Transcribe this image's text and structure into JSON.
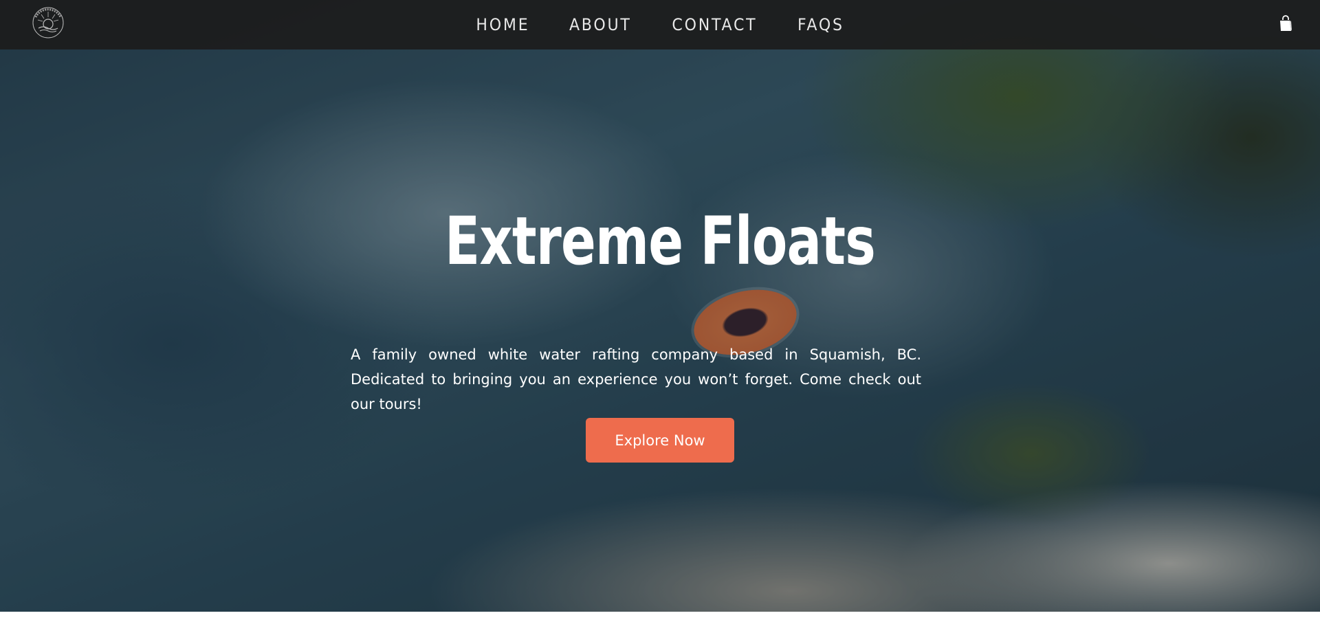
{
  "header": {
    "logo_icon": "extreme-floats-circular-logo",
    "nav": [
      {
        "label": "HOME"
      },
      {
        "label": "ABOUT"
      },
      {
        "label": "CONTACT"
      },
      {
        "label": "FAQS"
      }
    ],
    "cart_icon": "shopping-bag-icon"
  },
  "hero": {
    "title": "Extreme Floats",
    "description": "A family owned white water rafting company based in Squamish, BC. Dedicated to bringing you an experience you won’t forget. Come check out our tours!",
    "cta_label": "Explore Now"
  },
  "colors": {
    "header_bg": "#1c1c1c",
    "cta": "#ee6c4d",
    "text": "#ffffff"
  }
}
